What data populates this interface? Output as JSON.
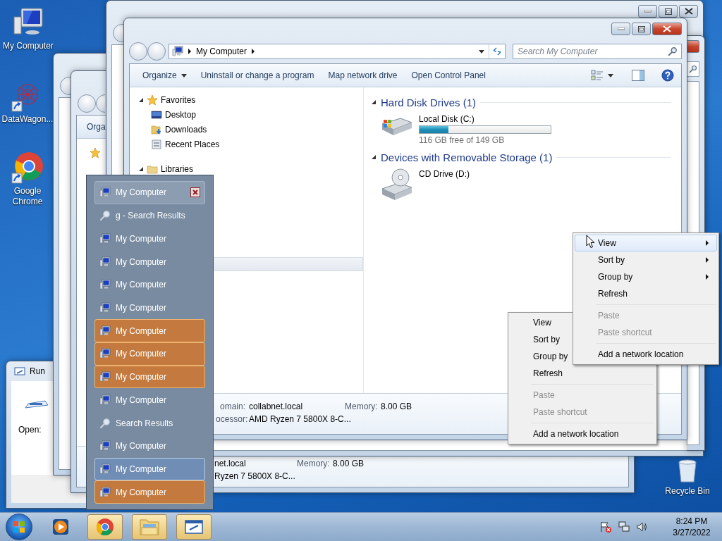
{
  "desktop_icons": [
    {
      "label": "My Computer"
    },
    {
      "label": "DataWagon..."
    },
    {
      "label": "Google Chrome"
    },
    {
      "label": "Recycle Bin"
    }
  ],
  "run_dialog": {
    "title": "Run",
    "open_label": "Open:"
  },
  "window_behind_left": {
    "toolbar_text": "Orga"
  },
  "window_behind_bottom": {
    "details": [
      {
        "value": "net.local"
      },
      {
        "label": "Memory:",
        "value": "8.00 GB"
      },
      {
        "value": "Ryzen 7 5800X 8-C..."
      }
    ]
  },
  "explorer": {
    "address": [
      "My Computer"
    ],
    "search": {
      "placeholder": "Search My Computer"
    },
    "toolbar": [
      {
        "label": "Organize",
        "dropdown": true
      },
      {
        "label": "Uninstall or change a program",
        "dropdown": false
      },
      {
        "label": "Map network drive",
        "dropdown": false
      },
      {
        "label": "Open Control Panel",
        "dropdown": false
      }
    ],
    "nav": [
      {
        "label": "Favorites",
        "expanded": true,
        "children": [
          {
            "label": "Desktop"
          },
          {
            "label": "Downloads"
          },
          {
            "label": "Recent Places"
          }
        ]
      },
      {
        "label": "Libraries",
        "expanded": true
      }
    ],
    "groups": [
      {
        "title": "Hard Disk Drives (1)",
        "drives": [
          {
            "name": "Local Disk (C:)",
            "kind": "disk",
            "level": 0.22,
            "free": "116 GB free of 149 GB"
          }
        ]
      },
      {
        "title": "Devices with Removable Storage (1)",
        "drives": [
          {
            "name": "CD Drive (D:)",
            "kind": "cd"
          }
        ]
      }
    ],
    "details": [
      {
        "label": "omain:",
        "value": "collabnet.local"
      },
      {
        "label": "Memory:",
        "value": "8.00 GB"
      },
      {
        "label": "ocessor:",
        "value": "AMD Ryzen 7 5800X 8-C..."
      }
    ]
  },
  "jump_list": [
    {
      "label": "My Computer",
      "kind": "computer",
      "hovered": true,
      "highlighted": false,
      "selected": false
    },
    {
      "label": "g - Search Results",
      "kind": "search",
      "hovered": false,
      "highlighted": false,
      "selected": false
    },
    {
      "label": "My Computer",
      "kind": "computer",
      "hovered": false,
      "highlighted": false,
      "selected": false
    },
    {
      "label": "My Computer",
      "kind": "computer",
      "hovered": false,
      "highlighted": false,
      "selected": false
    },
    {
      "label": "My Computer",
      "kind": "computer",
      "hovered": false,
      "highlighted": false,
      "selected": false
    },
    {
      "label": "My Computer",
      "kind": "computer",
      "hovered": false,
      "highlighted": false,
      "selected": false
    },
    {
      "label": "My Computer",
      "kind": "computer",
      "hovered": false,
      "highlighted": true,
      "selected": false
    },
    {
      "label": "My Computer",
      "kind": "computer",
      "hovered": false,
      "highlighted": true,
      "selected": false
    },
    {
      "label": "My Computer",
      "kind": "computer",
      "hovered": false,
      "highlighted": true,
      "selected": false
    },
    {
      "label": "My Computer",
      "kind": "computer",
      "hovered": false,
      "highlighted": false,
      "selected": false
    },
    {
      "label": "Search Results",
      "kind": "search",
      "hovered": false,
      "highlighted": false,
      "selected": false
    },
    {
      "label": "My Computer",
      "kind": "computer",
      "hovered": false,
      "highlighted": false,
      "selected": false
    },
    {
      "label": "My Computer",
      "kind": "computer",
      "hovered": false,
      "highlighted": false,
      "selected": true
    },
    {
      "label": "My Computer",
      "kind": "computer",
      "hovered": false,
      "highlighted": true,
      "selected": false
    }
  ],
  "context_menus": [
    {
      "items": [
        {
          "kind": "item",
          "label": "View",
          "disabled": false,
          "hover": false
        },
        {
          "kind": "item",
          "label": "Sort by",
          "disabled": false,
          "hover": false
        },
        {
          "kind": "item",
          "label": "Group by",
          "disabled": false,
          "hover": false
        },
        {
          "kind": "item",
          "label": "Refresh",
          "disabled": false,
          "hover": false
        },
        {
          "kind": "separator"
        },
        {
          "kind": "item",
          "label": "Paste",
          "disabled": true,
          "hover": false
        },
        {
          "kind": "item",
          "label": "Paste shortcut",
          "disabled": true,
          "hover": false
        },
        {
          "kind": "separator"
        },
        {
          "kind": "item",
          "label": "Add a network location",
          "disabled": false,
          "hover": false
        }
      ]
    },
    {
      "items": [
        {
          "kind": "item",
          "label": "View",
          "disabled": false,
          "submenu": true,
          "hover": true
        },
        {
          "kind": "item",
          "label": "Sort by",
          "disabled": false,
          "submenu": true,
          "hover": false
        },
        {
          "kind": "item",
          "label": "Group by",
          "disabled": false,
          "submenu": true,
          "hover": false
        },
        {
          "kind": "item",
          "label": "Refresh",
          "disabled": false,
          "submenu": false,
          "hover": false
        },
        {
          "kind": "separator"
        },
        {
          "kind": "item",
          "label": "Paste",
          "disabled": true,
          "submenu": false,
          "hover": false
        },
        {
          "kind": "item",
          "label": "Paste shortcut",
          "disabled": true,
          "submenu": false,
          "hover": false
        },
        {
          "kind": "separator"
        },
        {
          "kind": "item",
          "label": "Add a network location",
          "disabled": false,
          "submenu": false,
          "hover": false
        }
      ]
    }
  ],
  "taskbar": {
    "buttons": [
      {
        "open": false
      },
      {
        "open": true
      },
      {
        "open": true
      },
      {
        "open": true
      }
    ],
    "time": "8:24 PM",
    "date": "3/27/2022"
  }
}
